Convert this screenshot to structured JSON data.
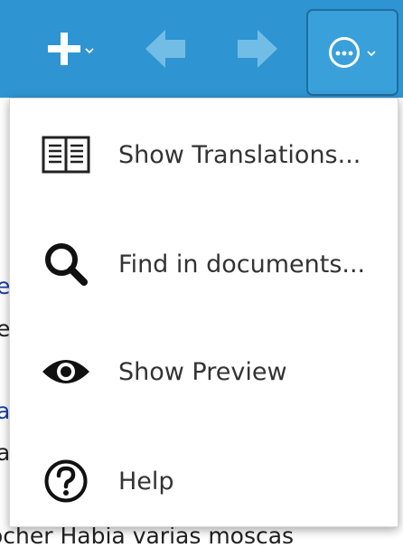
{
  "toolbar": {
    "background_color": "#2e95d2",
    "buttons": [
      {
        "name": "add-button",
        "icon": "plus-icon",
        "has_dropdown": true
      },
      {
        "name": "back-button",
        "icon": "arrow-left-icon",
        "enabled": false
      },
      {
        "name": "forward-button",
        "icon": "arrow-right-icon",
        "enabled": false
      },
      {
        "name": "more-button",
        "icon": "ellipsis-circle-icon",
        "has_dropdown": true,
        "active": true
      }
    ]
  },
  "background_page": {
    "lines": [
      {
        "text": "e",
        "color": "#1a3ea8"
      },
      {
        "text": "e",
        "color": "#222222"
      },
      {
        "text": "a",
        "color": "#1a3ea8"
      },
      {
        "text": "a",
        "color": "#222222"
      },
      {
        "text": "ocher  Habia  varias  moscas",
        "color": "#222222"
      }
    ]
  },
  "menu": {
    "items": [
      {
        "label": "Show Translations...",
        "icon": "book-icon"
      },
      {
        "label": "Find in documents...",
        "icon": "search-icon"
      },
      {
        "label": "Show Preview",
        "icon": "eye-icon"
      },
      {
        "label": "Help",
        "icon": "help-icon"
      }
    ]
  }
}
